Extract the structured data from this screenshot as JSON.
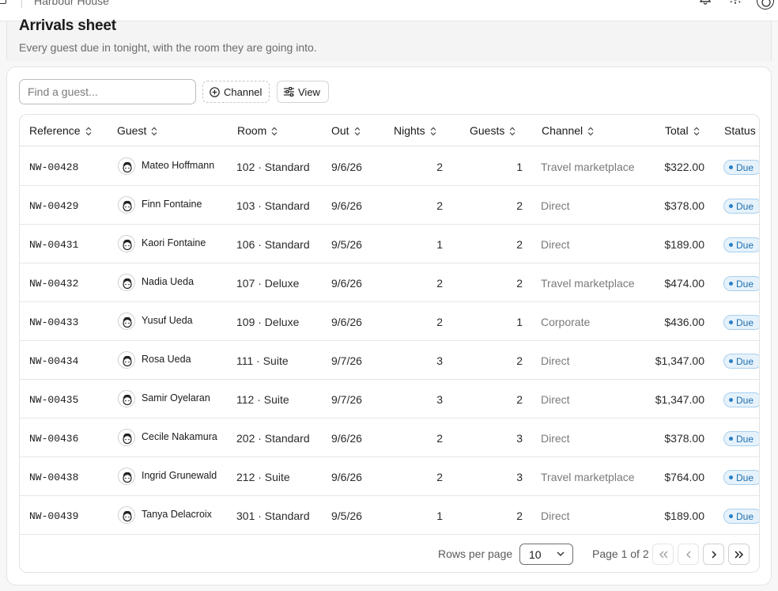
{
  "header": {
    "breadcrumb": "Harbour House"
  },
  "page": {
    "title": "Arrivals sheet",
    "subtitle": "Every guest due in tonight, with the room they are going into."
  },
  "toolbar": {
    "search_placeholder": "Find a guest...",
    "channel_label": "Channel",
    "view_label": "View"
  },
  "table": {
    "columns": [
      "Reference",
      "Guest",
      "Room",
      "Out",
      "Nights",
      "Guests",
      "Channel",
      "Total",
      "Status"
    ],
    "rows": [
      {
        "ref": "NW-00428",
        "guest": "Mateo Hoffmann",
        "room": "102 · Standard",
        "out": "9/6/26",
        "nights": "2",
        "guests": "1",
        "channel": "Travel marketplace",
        "total": "$322.00",
        "status": "Due"
      },
      {
        "ref": "NW-00429",
        "guest": "Finn Fontaine",
        "room": "103 · Standard",
        "out": "9/6/26",
        "nights": "2",
        "guests": "2",
        "channel": "Direct",
        "total": "$378.00",
        "status": "Due"
      },
      {
        "ref": "NW-00431",
        "guest": "Kaori Fontaine",
        "room": "106 · Standard",
        "out": "9/5/26",
        "nights": "1",
        "guests": "2",
        "channel": "Direct",
        "total": "$189.00",
        "status": "Due"
      },
      {
        "ref": "NW-00432",
        "guest": "Nadia Ueda",
        "room": "107 · Deluxe",
        "out": "9/6/26",
        "nights": "2",
        "guests": "2",
        "channel": "Travel marketplace",
        "total": "$474.00",
        "status": "Due"
      },
      {
        "ref": "NW-00433",
        "guest": "Yusuf Ueda",
        "room": "109 · Deluxe",
        "out": "9/6/26",
        "nights": "2",
        "guests": "1",
        "channel": "Corporate",
        "total": "$436.00",
        "status": "Due"
      },
      {
        "ref": "NW-00434",
        "guest": "Rosa Ueda",
        "room": "111 · Suite",
        "out": "9/7/26",
        "nights": "3",
        "guests": "2",
        "channel": "Direct",
        "total": "$1,347.00",
        "status": "Due"
      },
      {
        "ref": "NW-00435",
        "guest": "Samir Oyelaran",
        "room": "112 · Suite",
        "out": "9/7/26",
        "nights": "3",
        "guests": "2",
        "channel": "Direct",
        "total": "$1,347.00",
        "status": "Due"
      },
      {
        "ref": "NW-00436",
        "guest": "Cecile Nakamura",
        "room": "202 · Standard",
        "out": "9/6/26",
        "nights": "2",
        "guests": "3",
        "channel": "Direct",
        "total": "$378.00",
        "status": "Due"
      },
      {
        "ref": "NW-00438",
        "guest": "Ingrid Grunewald",
        "room": "212 · Suite",
        "out": "9/6/26",
        "nights": "2",
        "guests": "3",
        "channel": "Travel marketplace",
        "total": "$764.00",
        "status": "Due"
      },
      {
        "ref": "NW-00439",
        "guest": "Tanya Delacroix",
        "room": "301 · Standard",
        "out": "9/5/26",
        "nights": "1",
        "guests": "2",
        "channel": "Direct",
        "total": "$189.00",
        "status": "Due"
      }
    ]
  },
  "pagination": {
    "rows_per_page_label": "Rows per page",
    "rows_per_page_value": "10",
    "page_info": "Page 1 of 2"
  },
  "colors": {
    "status_badge_bg": "#e6f2fb",
    "status_badge_text": "#1f6fb0",
    "muted_text": "#7a7a7a"
  },
  "icons": {
    "topbar": [
      "sidebar-toggle-icon",
      "bell-icon",
      "sun-icon",
      "avatar"
    ],
    "toolbar": [
      "plus-circle-icon",
      "sliders-icon"
    ],
    "pagination": [
      "first-page-icon",
      "prev-page-icon",
      "next-page-icon",
      "last-page-icon"
    ]
  }
}
